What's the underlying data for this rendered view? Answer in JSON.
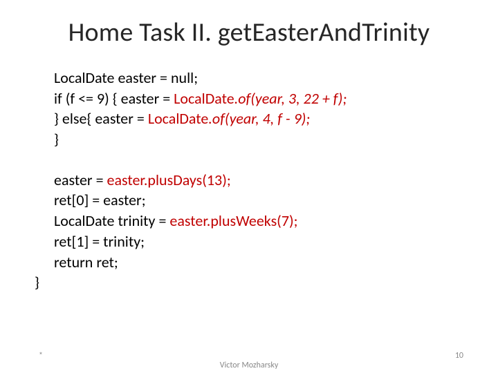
{
  "title": "Home Task II. getEasterAndTrinity",
  "code": {
    "l1": "LocalDate easter = null;",
    "l2a": "if (f <= 9) { easter = ",
    "l2b": "LocalDate",
    "l2c": ".",
    "l2d": "of(year, 3, 22 + f);",
    "l3a": "} else{ easter = ",
    "l3b": "LocalDate",
    "l3c": ".",
    "l3d": "of(year, 4, f - 9);",
    "l4": "}",
    "l6a": "easter = ",
    "l6b": "easter.plusDays(13);",
    "l7": "ret[0] = easter;",
    "l8a": "LocalDate trinity = ",
    "l8b": "easter.plusWeeks(7);",
    "l9": "ret[1] = trinity;",
    "l10": "return ret;",
    "l11": "}"
  },
  "footer": {
    "bullet": "*",
    "author": "Victor Mozharsky",
    "page": "10"
  }
}
